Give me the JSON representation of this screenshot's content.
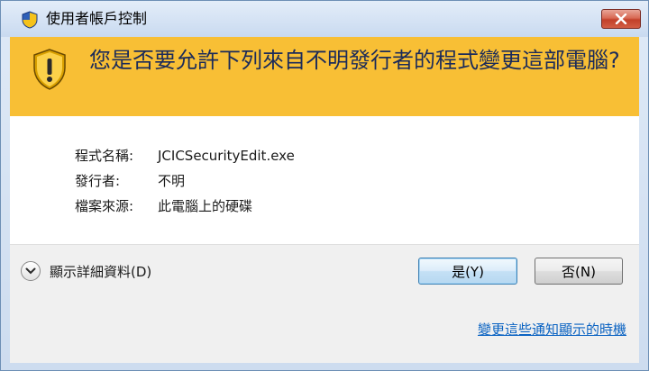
{
  "window": {
    "title": "使用者帳戶控制",
    "close_icon": "close-icon"
  },
  "banner": {
    "headline": "您是否要允許下列來自不明發行者的程式變更這部電腦?",
    "icon": "warning-shield-icon",
    "background_color": "#f8bf35"
  },
  "details": {
    "program_name_label": "程式名稱:",
    "program_name_value": "JCICSecurityEdit.exe",
    "publisher_label": "發行者:",
    "publisher_value": "不明",
    "file_origin_label": "檔案來源:",
    "file_origin_value": "此電腦上的硬碟"
  },
  "footer": {
    "show_details_label": "顯示詳細資料(D)",
    "yes_label": "是(Y)",
    "no_label": "否(N)",
    "change_notify_link": "變更這些通知顯示的時機",
    "link_color": "#0b63c2"
  }
}
